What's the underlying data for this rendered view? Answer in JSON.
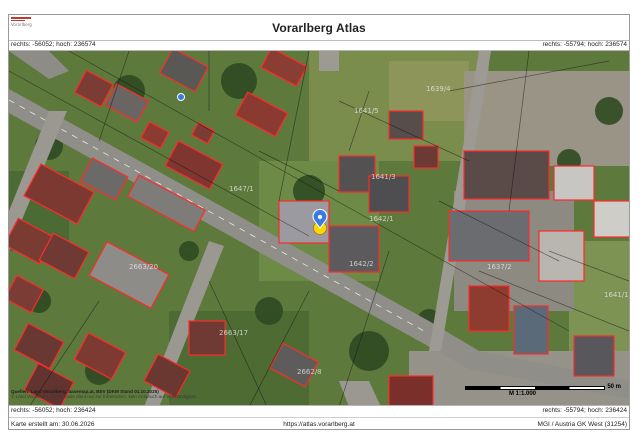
{
  "header": {
    "title": "Vorarlberg Atlas",
    "logo_text": "Vorarlberg"
  },
  "coords": {
    "top_left": "rechts: -56052; hoch: 236574",
    "top_right": "rechts: -55794; hoch: 236574",
    "bottom_left": "rechts: -56052; hoch: 236424",
    "bottom_right": "rechts: -55794; hoch: 236424"
  },
  "footer": {
    "created": "Karte erstellt am: 30.06.2026",
    "url": "https://atlas.vorarlberg.at",
    "projection": "MGI / Austria GK West (31254)"
  },
  "attribution": {
    "source": "Quellen: Land Vorarlberg, basemap.at, BEV (DKM Stand 01.10.2025)",
    "disclaimer": "© Land Vorarlberg. Diese Karte dient nur zur Information; kein Anspruch auf Vollständigkeit."
  },
  "scale": {
    "ratio": "M 1:1.000",
    "distance": "50 m"
  },
  "parcels": {
    "p1": "1639/4",
    "p2": "1641/5",
    "p3": "1642/1",
    "p4": "1641/3",
    "p5": "1642/2",
    "p6": "1637/2",
    "p7": "1641/1",
    "p8": "2663/20",
    "p9": "2663/17",
    "p10": "2662/8",
    "p11": "1647/1"
  },
  "colors": {
    "building_outline": "#ff2a2a",
    "marker_blue": "#3a7be0",
    "marker_yellow": "#ffd500"
  }
}
